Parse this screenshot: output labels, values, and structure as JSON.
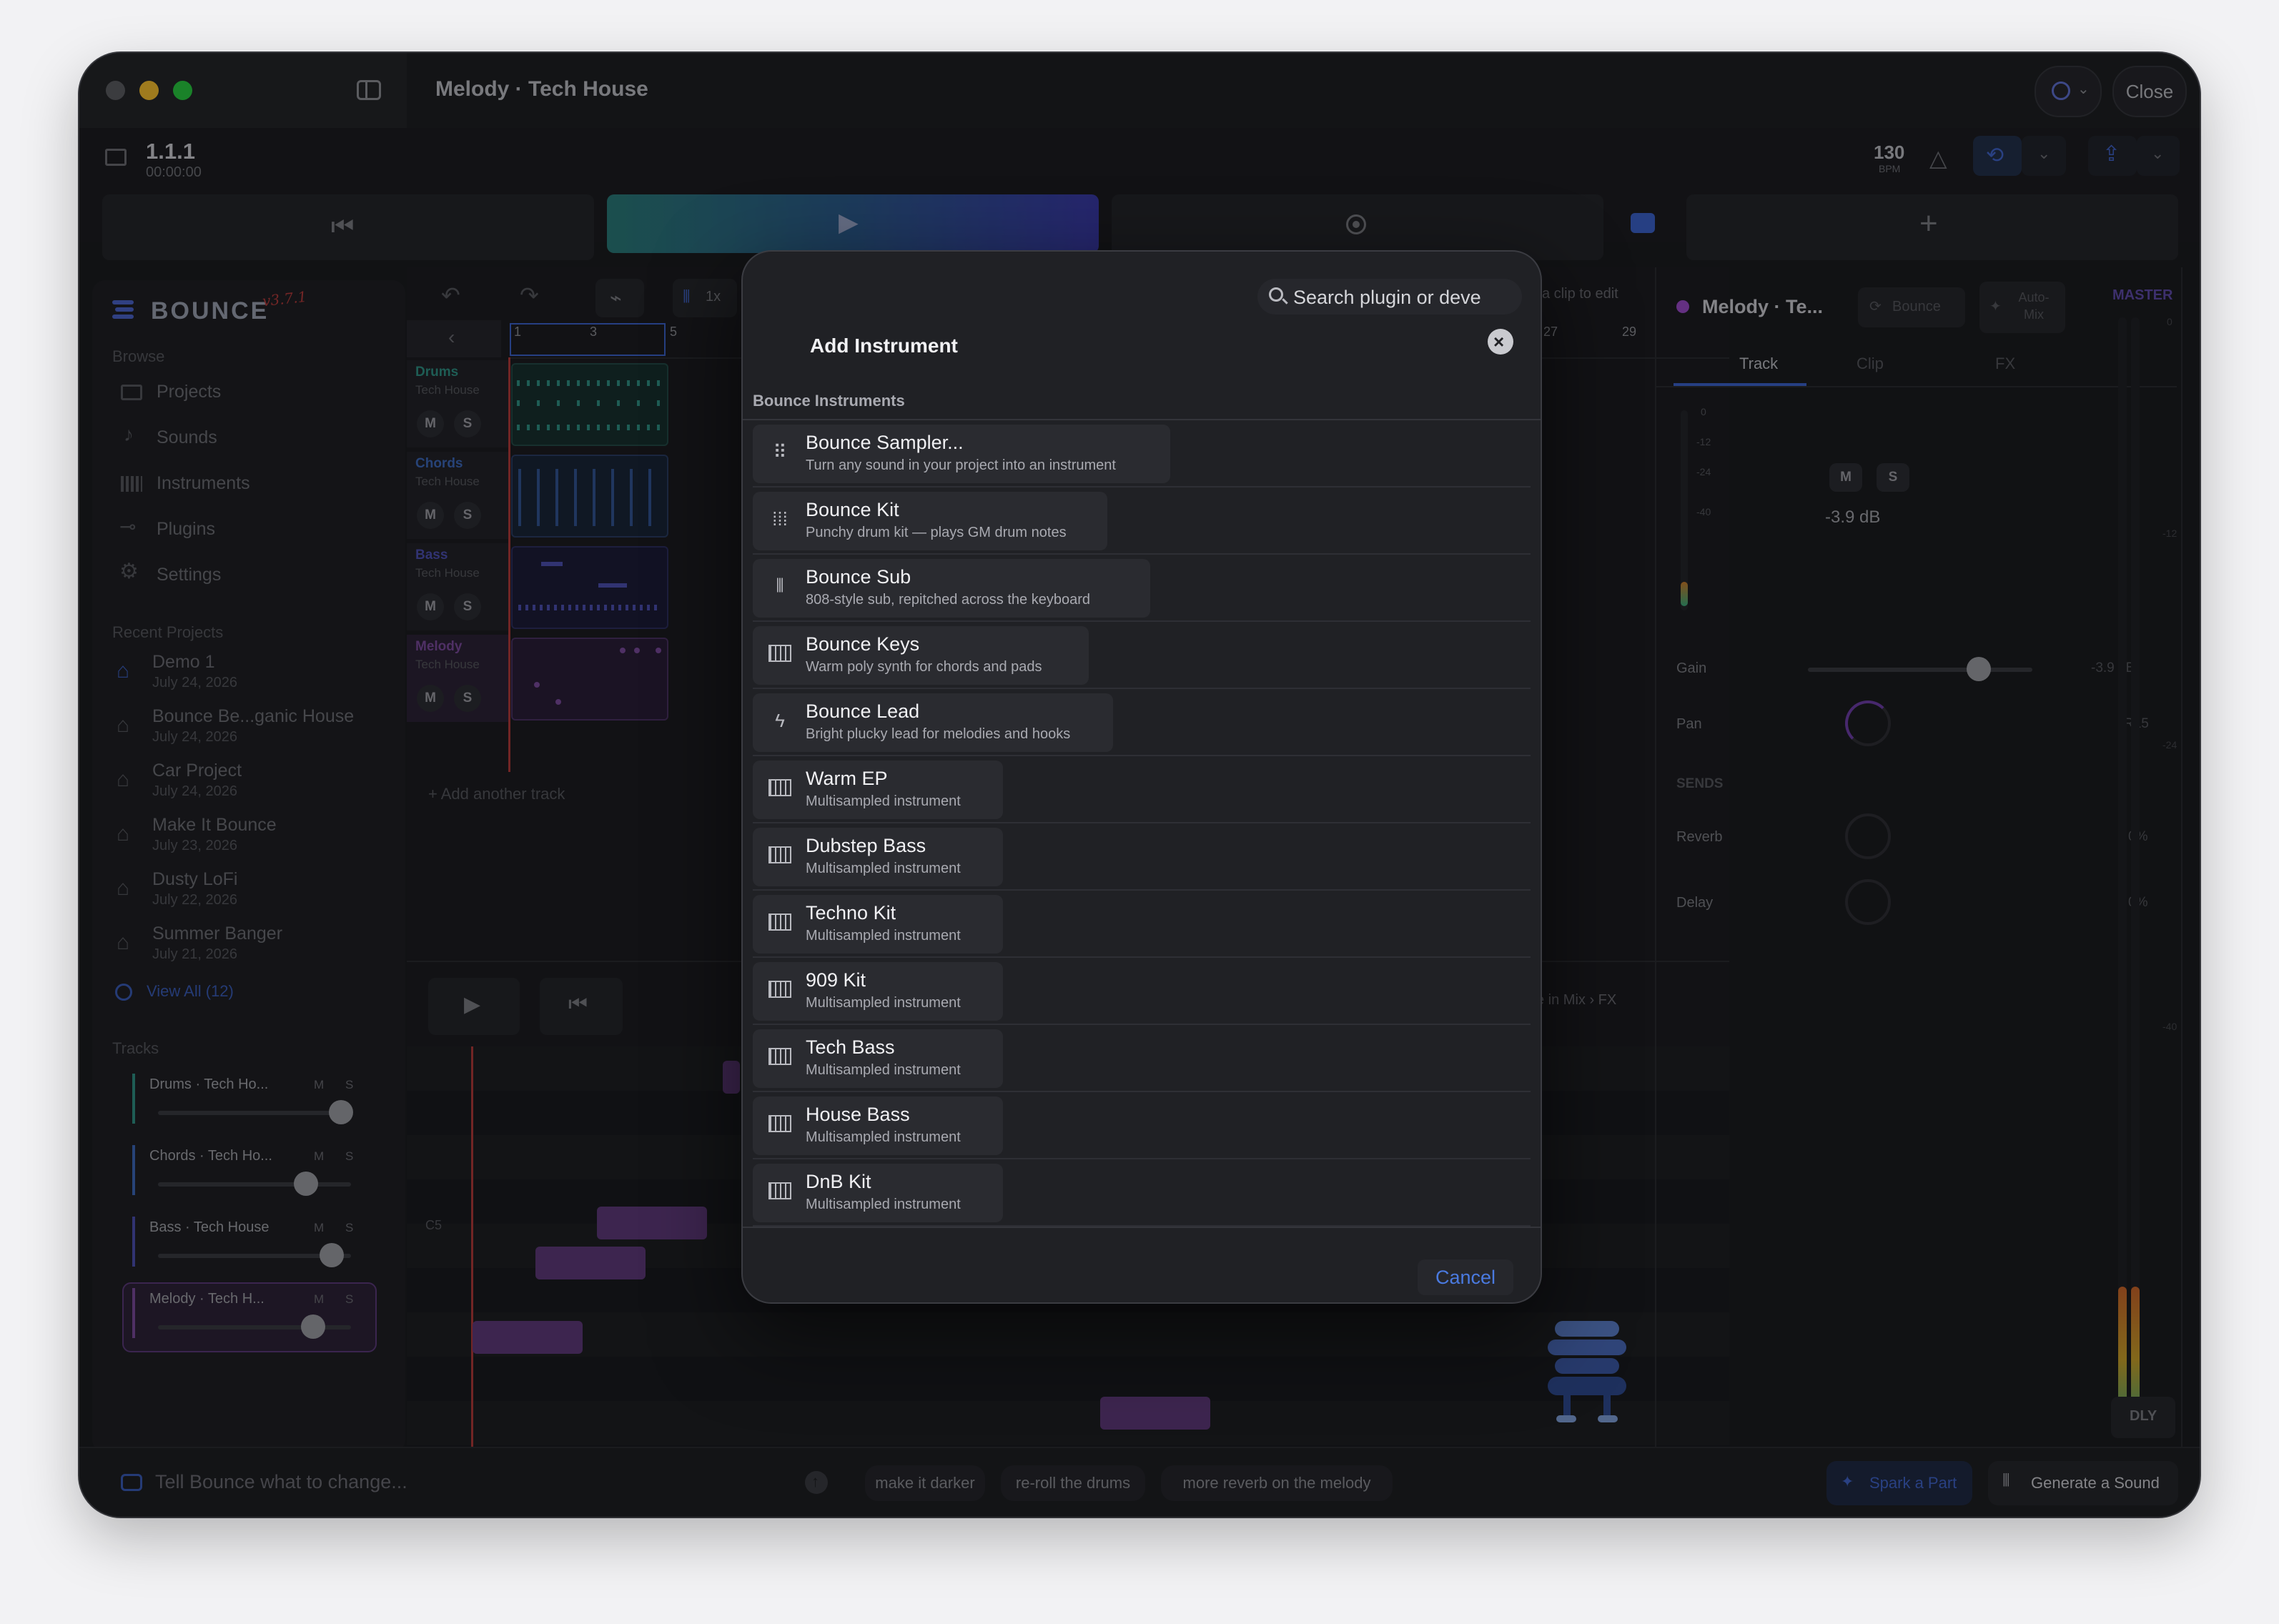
{
  "window": {
    "title": "Melody · Tech House",
    "close_label": "Close"
  },
  "transport": {
    "position": "1.1.1",
    "time": "00:00:00",
    "bpm": "130",
    "bpm_label": "BPM"
  },
  "sidebar": {
    "logo": "BOUNCE",
    "version": "v3.7.1",
    "browse_heading": "Browse",
    "browse_items": [
      "Projects",
      "Sounds",
      "Instruments",
      "Plugins",
      "Settings"
    ],
    "recent_heading": "Recent Projects",
    "recent": [
      {
        "name": "Demo 1",
        "date": "July 24, 2026"
      },
      {
        "name": "Bounce Be...ganic House",
        "date": "July 24, 2026"
      },
      {
        "name": "Car Project",
        "date": "July 24, 2026"
      },
      {
        "name": "Make It Bounce",
        "date": "July 23, 2026"
      },
      {
        "name": "Dusty LoFi",
        "date": "July 22, 2026"
      },
      {
        "name": "Summer Banger",
        "date": "July 21, 2026"
      }
    ],
    "view_all": "View All (12)",
    "tracks_heading": "Tracks",
    "tracks": [
      {
        "name": "Drums · Tech Ho...",
        "m": "M",
        "s": "S",
        "level": 0.9
      },
      {
        "name": "Chords · Tech Ho...",
        "m": "M",
        "s": "S",
        "level": 0.71
      },
      {
        "name": "Bass · Tech House",
        "m": "M",
        "s": "S",
        "level": 0.84
      },
      {
        "name": "Melody · Tech H...",
        "m": "M",
        "s": "S",
        "level": 0.73
      }
    ]
  },
  "arrangement": {
    "zoom": "1x",
    "ruler": [
      "1",
      "3",
      "5",
      "27",
      "29"
    ],
    "hint": "a clip to edit",
    "tracks": [
      {
        "name": "Drums",
        "genre": "Tech House",
        "color": "#2f8f83"
      },
      {
        "name": "Chords",
        "genre": "Tech House",
        "color": "#3c68b8"
      },
      {
        "name": "Bass",
        "genre": "Tech House",
        "color": "#4c4fb0"
      },
      {
        "name": "Melody",
        "genre": "Tech House",
        "color": "#7a4a9c"
      }
    ],
    "mute": "M",
    "solo": "S",
    "add_track": "Add another track",
    "editor_hint": "e in Mix › FX",
    "note_label": "C5"
  },
  "inspector": {
    "title": "Melody · Te...",
    "bounce_label": "Bounce",
    "automix_label": "Auto-Mix",
    "tabs": [
      "Track",
      "Clip",
      "FX"
    ],
    "meter_marks": [
      "0",
      "-12",
      "-24",
      "-40"
    ],
    "level": "-3.9 dB",
    "m": "M",
    "s": "S",
    "gain_label": "Gain",
    "gain_value": "-3.9 dB",
    "gain_level": 0.76,
    "pan_label": "Pan",
    "pan_value": "R15",
    "sends_heading": "SENDS",
    "reverb_label": "Reverb",
    "reverb_value": "0%",
    "delay_label": "Delay",
    "delay_value": "0%"
  },
  "master": {
    "label": "MASTER",
    "marks": [
      "0",
      "-12",
      "-24",
      "-40"
    ],
    "dly": "DLY"
  },
  "modal": {
    "search_placeholder": "Search plugin or deve",
    "title": "Add Instrument",
    "section": "Bounce Instruments",
    "cancel": "Cancel",
    "items": [
      {
        "title": "Bounce Sampler...",
        "sub": "Turn any sound in your project into an instrument",
        "icon": "grid-dots-icon"
      },
      {
        "title": "Bounce Kit",
        "sub": "Punchy drum kit — plays GM drum notes",
        "icon": "drum-pads-icon"
      },
      {
        "title": "Bounce Sub",
        "sub": "808-style sub, repitched across the keyboard",
        "icon": "waveform-icon"
      },
      {
        "title": "Bounce Keys",
        "sub": "Warm poly synth for chords and pads",
        "icon": "piano-icon"
      },
      {
        "title": "Bounce Lead",
        "sub": "Bright plucky lead for melodies and hooks",
        "icon": "bolt-icon"
      },
      {
        "title": "Warm EP",
        "sub": "Multisampled instrument",
        "icon": "piano-icon"
      },
      {
        "title": "Dubstep Bass",
        "sub": "Multisampled instrument",
        "icon": "piano-icon"
      },
      {
        "title": "Techno Kit",
        "sub": "Multisampled instrument",
        "icon": "piano-icon"
      },
      {
        "title": "909 Kit",
        "sub": "Multisampled instrument",
        "icon": "piano-icon"
      },
      {
        "title": "Tech Bass",
        "sub": "Multisampled instrument",
        "icon": "piano-icon"
      },
      {
        "title": "House Bass",
        "sub": "Multisampled instrument",
        "icon": "piano-icon"
      },
      {
        "title": "DnB Kit",
        "sub": "Multisampled instrument",
        "icon": "piano-icon"
      }
    ]
  },
  "bottombar": {
    "prompt_placeholder": "Tell Bounce what to change...",
    "chips": [
      "make it darker",
      "re-roll the drums",
      "more reverb on the melody"
    ],
    "spark": "Spark a Part",
    "generate": "Generate a Sound"
  }
}
